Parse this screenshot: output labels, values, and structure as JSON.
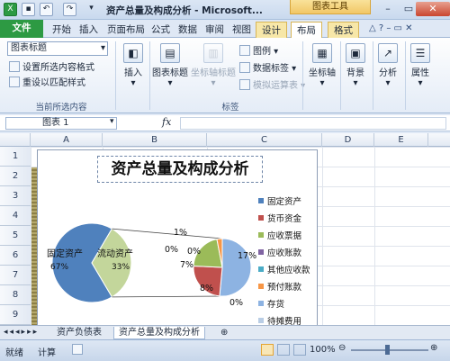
{
  "window": {
    "title": "资产总量及构成分析 - Microsoft...",
    "context_tab_group": "图表工具",
    "minimize": "–",
    "maximize": "▭",
    "close": "✕"
  },
  "tabs": {
    "file": "文件",
    "items": [
      "开始",
      "插入",
      "页面布局",
      "公式",
      "数据",
      "审阅",
      "视图",
      "设计",
      "布局",
      "格式"
    ],
    "active": "布局"
  },
  "ribbon": {
    "selection_combo": "图表标题",
    "format_selection": "设置所选内容格式",
    "reset_style": "重设以匹配样式",
    "group_current": "当前所选内容",
    "insert": "插入",
    "chart_title": "图表标题",
    "axis_title": "坐标轴标题",
    "legend": "图例",
    "data_labels": "数据标签",
    "data_table": "模拟运算表",
    "group_labels": "标签",
    "axes": "坐标轴",
    "background": "背景",
    "analysis": "分析",
    "properties": "属性"
  },
  "formula_bar": {
    "name_box": "图表 1",
    "fx": "fx"
  },
  "grid": {
    "columns": [
      "A",
      "B",
      "C",
      "D",
      "E"
    ],
    "rows": [
      "1",
      "2",
      "3",
      "4",
      "5",
      "6",
      "7",
      "8",
      "9"
    ]
  },
  "chart_data": {
    "type": "pie",
    "title": "资产总量及构成分析",
    "main_pie": [
      {
        "label": "固定资产",
        "value": 67,
        "label_text": "67%"
      },
      {
        "label": "流动资产",
        "value": 33,
        "label_text": "33%"
      }
    ],
    "secondary_pie": [
      {
        "label": "存货",
        "value": 17,
        "label_text": "17%"
      },
      {
        "label": "其他",
        "value": 8,
        "label_text": "8%"
      },
      {
        "label": "应收票据",
        "value": 7,
        "label_text": "7%"
      },
      {
        "label": "预付账款",
        "value": 1,
        "label_text": "1%"
      },
      {
        "label": "其他应收款",
        "value": 0,
        "label_text": "0%"
      }
    ],
    "extra_labels": [
      "0%",
      "0%"
    ],
    "legend": [
      {
        "name": "固定资产",
        "color": "#4f81bd"
      },
      {
        "name": "货币资金",
        "color": "#c0504d"
      },
      {
        "name": "应收票据",
        "color": "#9bbb59"
      },
      {
        "name": "应收账款",
        "color": "#8064a2"
      },
      {
        "name": "其他应收款",
        "color": "#4bacc6"
      },
      {
        "name": "预付账款",
        "color": "#f79646"
      },
      {
        "name": "存货",
        "color": "#8db3e2"
      },
      {
        "name": "待摊费用",
        "color": "#b9cde5"
      }
    ]
  },
  "sheet_tabs": {
    "items": [
      "资产负债表",
      "资产总量及构成分析"
    ],
    "active": "资产总量及构成分析"
  },
  "status": {
    "ready": "就绪",
    "calc": "计算",
    "zoom": "100%"
  }
}
